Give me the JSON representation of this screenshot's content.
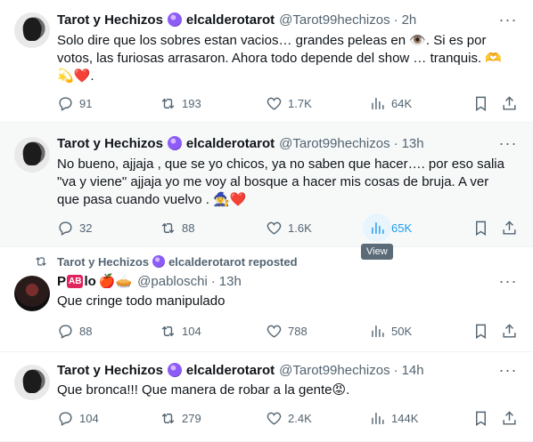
{
  "tweets": [
    {
      "name": "Tarot y Hechizos",
      "badge_icon": "crystal-ball-emoji",
      "display_tag": "elcalderotarot",
      "handle": "@Tarot99hechizos",
      "time": "2h",
      "lines": [
        "Solo dire que los sobres estan vacios… grandes peleas en 👁️. Si es por",
        "votos, las furiosas arrasaron. Ahora todo depende del show … tranquis. 🫶",
        "💫❤️."
      ],
      "replies": "91",
      "reposts": "193",
      "likes": "1.7K",
      "views": "64K"
    },
    {
      "name": "Tarot y Hechizos",
      "badge_icon": "crystal-ball-emoji",
      "display_tag": "elcalderotarot",
      "handle": "@Tarot99hechizos",
      "time": "13h",
      "lines": [
        "No bueno, ajjaja , que se yo chicos, ya no saben que hacer…. por eso salia",
        "\"va y viene\" ajjaja  yo me voy al bosque a hacer mis cosas de bruja. A ver",
        "que pasa cuando vuelvo . 🧙‍♀️❤️"
      ],
      "replies": "32",
      "reposts": "88",
      "likes": "1.6K",
      "views": "65K",
      "tooltip": "View"
    },
    {
      "repost_by": "Tarot y Hechizos",
      "repost_tag": "elcalderotarot reposted",
      "name_prefix": "P",
      "name_box": "AB",
      "name_suffix": "lo",
      "name_emojis": "🍎🥧",
      "handle": "@pabloschi",
      "time": "13h",
      "lines": [
        "Que cringe todo manipulado"
      ],
      "replies": "88",
      "reposts": "104",
      "likes": "788",
      "views": "50K"
    },
    {
      "name": "Tarot y Hechizos",
      "badge_icon": "crystal-ball-emoji",
      "display_tag": "elcalderotarot",
      "handle": "@Tarot99hechizos",
      "time": "14h",
      "lines": [
        "Que bronca!!! Que manera de robar a la gente😡."
      ],
      "replies": "104",
      "reposts": "279",
      "likes": "2.4K",
      "views": "144K"
    }
  ],
  "more_glyph": "···",
  "dot": "·"
}
